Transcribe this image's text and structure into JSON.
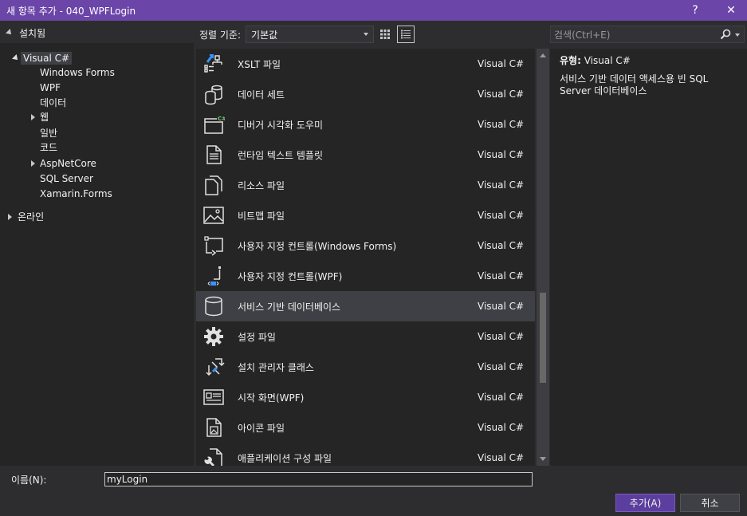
{
  "window": {
    "title": "새 항목 추가 - 040_WPFLogin",
    "help_label": "?",
    "close_label": "✕"
  },
  "tree": {
    "header": "설치됨",
    "items": [
      {
        "label": "Visual C#"
      },
      {
        "label": "Windows Forms"
      },
      {
        "label": "WPF"
      },
      {
        "label": "데이터"
      },
      {
        "label": "웹"
      },
      {
        "label": "일반"
      },
      {
        "label": "코드"
      },
      {
        "label": "AspNetCore"
      },
      {
        "label": "SQL Server"
      },
      {
        "label": "Xamarin.Forms"
      },
      {
        "label": "온라인"
      }
    ]
  },
  "toolbar": {
    "sort_label": "정렬 기준:",
    "sort_value": "기본값"
  },
  "search": {
    "placeholder": "검색(Ctrl+E)"
  },
  "templates": [
    {
      "name": "XSLT 파일",
      "type": "Visual C#",
      "icon": "xslt-icon"
    },
    {
      "name": "데이터 세트",
      "type": "Visual C#",
      "icon": "dataset-icon"
    },
    {
      "name": "디버거 시각화 도우미",
      "type": "Visual C#",
      "icon": "debugger-visualizer-icon"
    },
    {
      "name": "런타임 텍스트 템플릿",
      "type": "Visual C#",
      "icon": "text-template-icon"
    },
    {
      "name": "리소스 파일",
      "type": "Visual C#",
      "icon": "resource-file-icon"
    },
    {
      "name": "비트맵 파일",
      "type": "Visual C#",
      "icon": "bitmap-icon"
    },
    {
      "name": "사용자 지정 컨트롤(Windows Forms)",
      "type": "Visual C#",
      "icon": "custom-control-icon"
    },
    {
      "name": "사용자 지정 컨트롤(WPF)",
      "type": "Visual C#",
      "icon": "wpf-control-icon"
    },
    {
      "name": "서비스 기반 데이터베이스",
      "type": "Visual C#",
      "icon": "database-icon"
    },
    {
      "name": "설정 파일",
      "type": "Visual C#",
      "icon": "settings-gear-icon"
    },
    {
      "name": "설치 관리자 클래스",
      "type": "Visual C#",
      "icon": "installer-class-icon"
    },
    {
      "name": "시작 화면(WPF)",
      "type": "Visual C#",
      "icon": "splash-screen-icon"
    },
    {
      "name": "아이콘 파일",
      "type": "Visual C#",
      "icon": "icon-file-icon"
    },
    {
      "name": "애플리케이션 구성 파일",
      "type": "Visual C#",
      "icon": "app-config-icon"
    }
  ],
  "selected_index": 8,
  "details": {
    "type_label": "유형:",
    "type_value": "Visual C#",
    "description": "서비스 기반 데이터 액세스용 빈 SQL Server 데이터베이스"
  },
  "form": {
    "name_label": "이름(N):",
    "name_value": "myLogin",
    "add_label": "추가(A)",
    "cancel_label": "취소"
  },
  "colors": {
    "titlebar": "#6b45a8",
    "accent_button": "#5c3e9e",
    "selection": "#3f3f46"
  }
}
